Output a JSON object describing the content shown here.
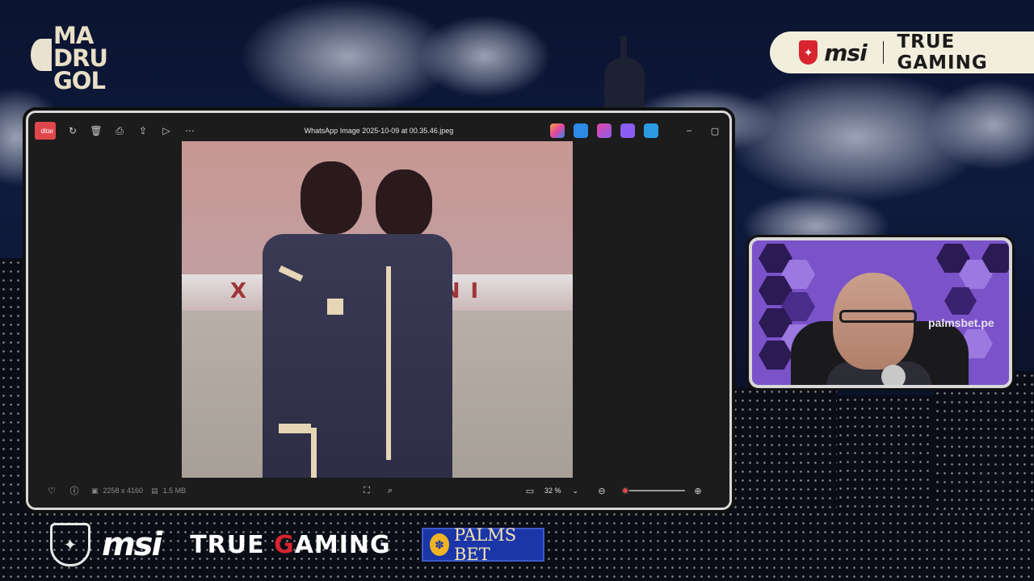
{
  "brand": {
    "madrugol_lines": [
      "MA",
      "DRU",
      "GOL"
    ],
    "top_msi": "msi",
    "top_tagline": "TRUE GAMING"
  },
  "viewer": {
    "edit_label": "ditar",
    "title": "WhatsApp Image 2025-10-09 at 00.35.46.jpeg",
    "toolbar_icons": [
      "rotate-icon",
      "delete-icon",
      "print-icon",
      "share-icon",
      "slideshow-icon",
      "more-icon"
    ],
    "app_icons": [
      {
        "name": "copilot-app-icon",
        "color": "#f1a33b"
      },
      {
        "name": "clipchamp-app-icon",
        "color": "#2d8ae6"
      },
      {
        "name": "designer-app-icon",
        "color": "#e347a3"
      },
      {
        "name": "paint-app-icon",
        "color": "#8a5cf0"
      },
      {
        "name": "onedrive-app-icon",
        "color": "#2a9be3"
      }
    ],
    "window_controls": [
      "–",
      "▢"
    ],
    "photo_banner_text": "X        INI ",
    "bottom": {
      "dimensions": "2258 x 4160",
      "file_size": "1.5 MB",
      "zoom": "32 %",
      "zoom_fraction": 0.05
    }
  },
  "webcam": {
    "sponsor_text": "palmsbet.pe"
  },
  "sponsors": {
    "msi": "msi",
    "tg_first": "TRUE ",
    "tg_red": "G",
    "tg_rest": "AMING",
    "palms": "PALMS BET"
  },
  "colors": {
    "accent_red": "#d8242f",
    "edit_red": "#e0474c",
    "cream": "#f2eedc",
    "webcam_purple": "#7a53c9",
    "palms_blue": "#1b36a8"
  }
}
